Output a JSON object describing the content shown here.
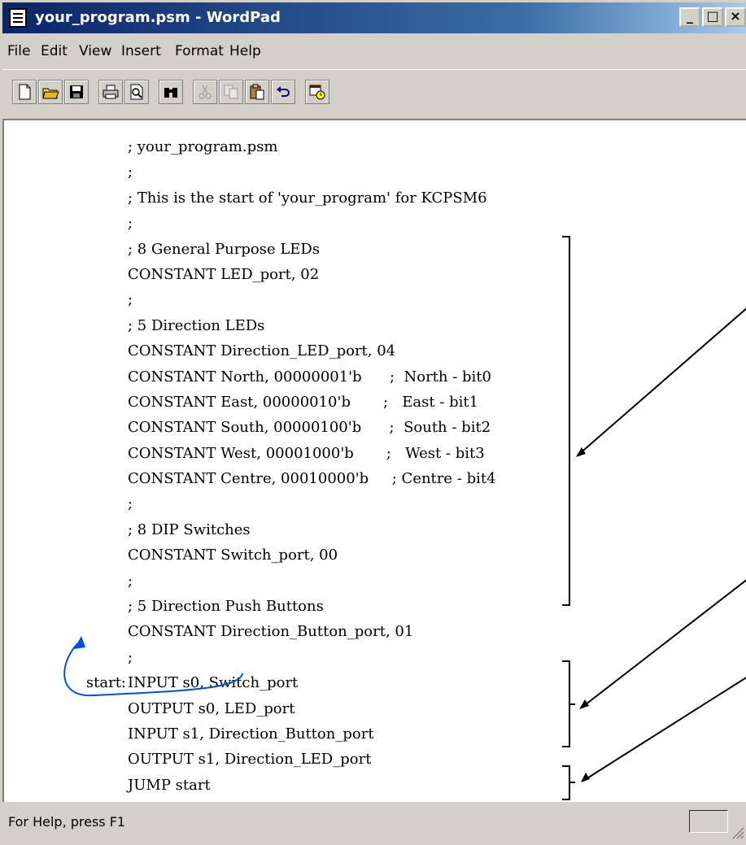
{
  "window": {
    "title": "your_program.psm - WordPad"
  },
  "title_buttons": {
    "minimize": "_",
    "maximize": "□",
    "close": "×"
  },
  "menu": [
    "File",
    "Edit",
    "View",
    "Insert",
    "Format",
    "Help"
  ],
  "toolbar_icons": [
    "new-document-icon",
    "open-folder-icon",
    "save-icon",
    "print-icon",
    "print-preview-icon",
    "find-binoculars-icon",
    "cut-icon",
    "copy-icon",
    "paste-icon",
    "undo-icon",
    "insert-date-time-icon"
  ],
  "code_lines": [
    {
      "label": "",
      "text": "; your_program.psm"
    },
    {
      "label": "",
      "text": ";"
    },
    {
      "label": "",
      "text": "; This is the start of 'your_program' for KCPSM6"
    },
    {
      "label": "",
      "text": ";"
    },
    {
      "label": "",
      "text": "; 8 General Purpose LEDs"
    },
    {
      "label": "",
      "text": "CONSTANT LED_port, 02"
    },
    {
      "label": "",
      "text": ";"
    },
    {
      "label": "",
      "text": "; 5 Direction LEDs"
    },
    {
      "label": "",
      "text": "CONSTANT Direction_LED_port, 04"
    },
    {
      "label": "",
      "text": "CONSTANT North, 00000001'b      ;  North - bit0"
    },
    {
      "label": "",
      "text": "CONSTANT East, 00000010'b       ;   East - bit1"
    },
    {
      "label": "",
      "text": "CONSTANT South, 00000100'b      ;  South - bit2"
    },
    {
      "label": "",
      "text": "CONSTANT West, 00001000'b       ;   West - bit3"
    },
    {
      "label": "",
      "text": "CONSTANT Centre, 00010000'b     ; Centre - bit4"
    },
    {
      "label": "",
      "text": ";"
    },
    {
      "label": "",
      "text": "; 8 DIP Switches"
    },
    {
      "label": "",
      "text": "CONSTANT Switch_port, 00"
    },
    {
      "label": "",
      "text": ";"
    },
    {
      "label": "",
      "text": "; 5 Direction Push Buttons"
    },
    {
      "label": "",
      "text": "CONSTANT Direction_Button_port, 01"
    },
    {
      "label": "",
      "text": ";"
    },
    {
      "label": "start:",
      "text": "INPUT s0, Switch_port"
    },
    {
      "label": "",
      "text": "OUTPUT s0, LED_port"
    },
    {
      "label": "",
      "text": "INPUT s1, Direction_Button_port"
    },
    {
      "label": "",
      "text": "OUTPUT s1, Direction_LED_port"
    },
    {
      "label": "",
      "text": "JUMP start"
    }
  ],
  "status": {
    "text": "For Help, press F1"
  },
  "colors": {
    "titlebar_start": "#0a246a",
    "titlebar_end": "#a6caf0",
    "annotation_arrow": "#0050e0"
  }
}
